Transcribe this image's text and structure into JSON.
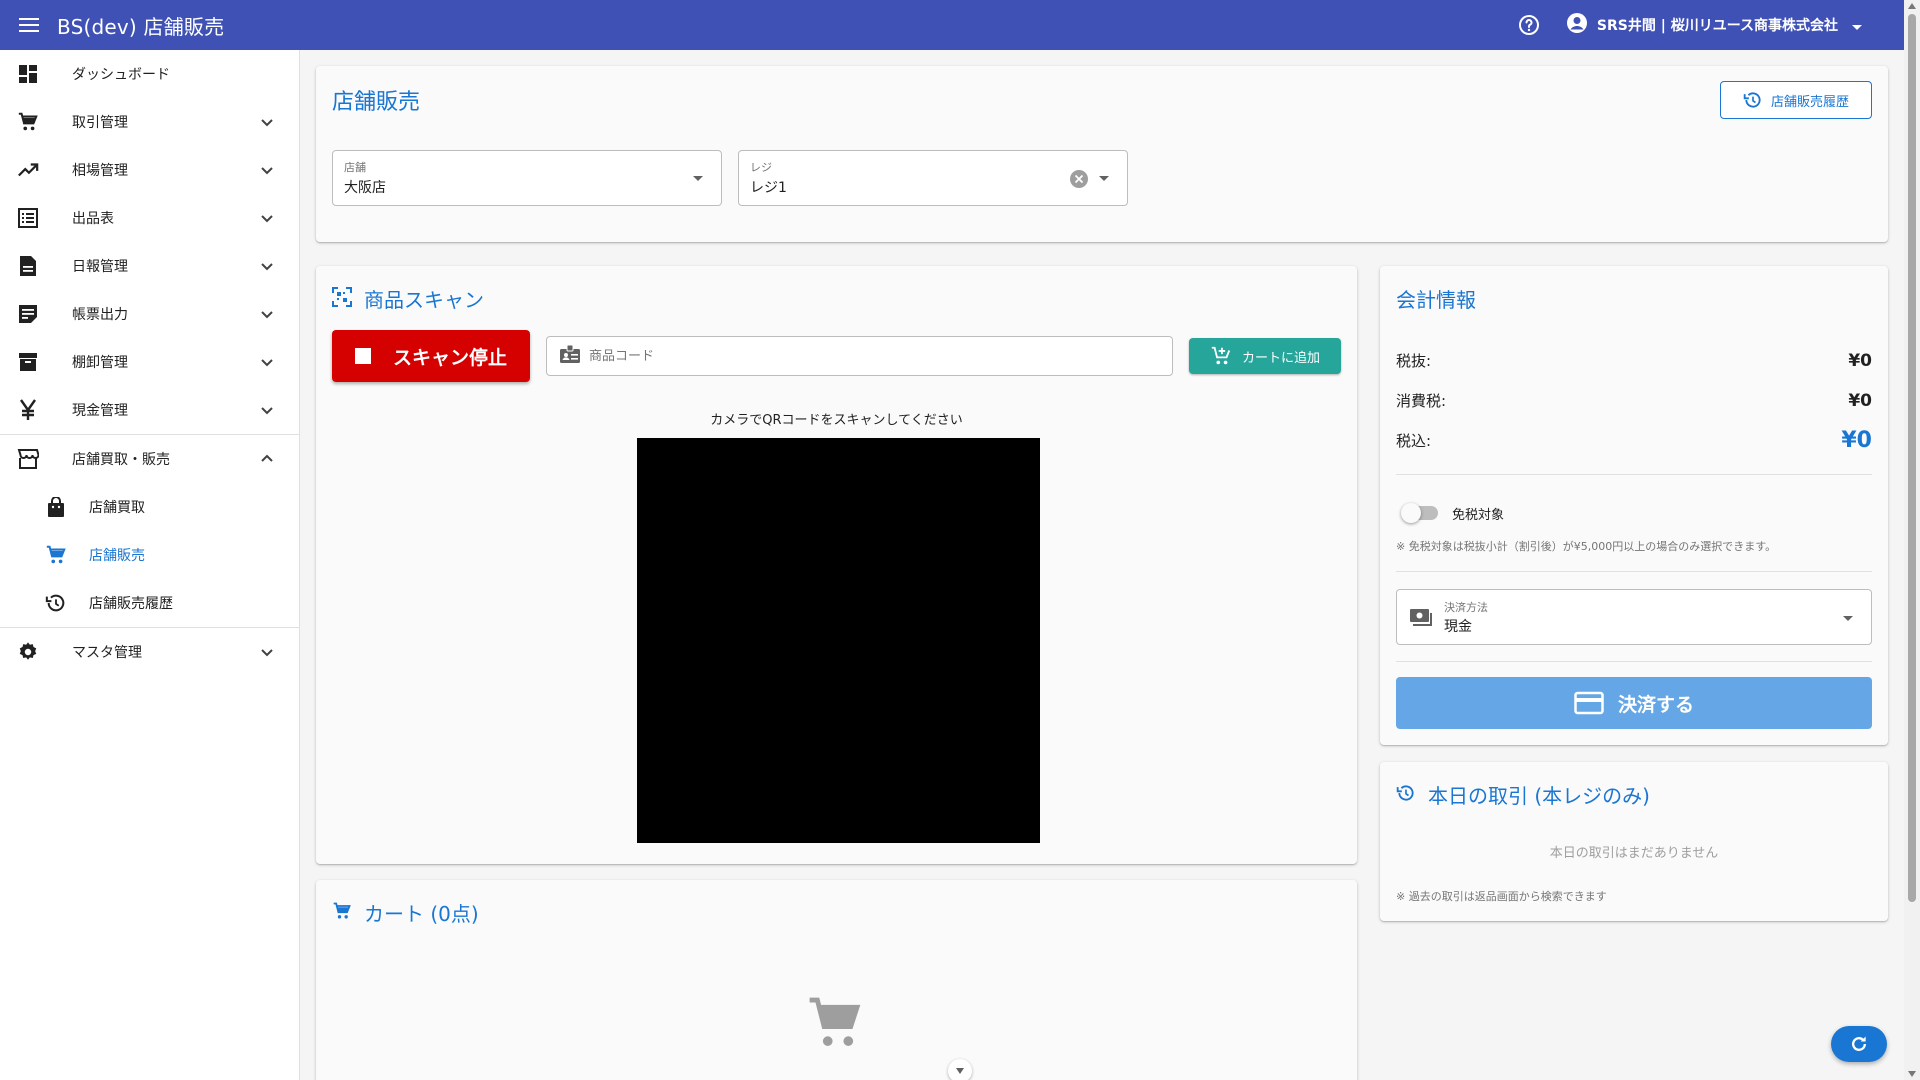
{
  "app": {
    "title": "BS(dev) 店舗販売"
  },
  "user": {
    "name": "SRS井間 | 桜川リユース商事株式会社"
  },
  "sidebar": {
    "items": [
      {
        "label": "ダッシュボード",
        "icon": "dashboard-icon"
      },
      {
        "label": "取引管理",
        "icon": "cart-icon"
      },
      {
        "label": "相場管理",
        "icon": "trending-up-icon"
      },
      {
        "label": "出品表",
        "icon": "list-icon"
      },
      {
        "label": "日報管理",
        "icon": "document-icon"
      },
      {
        "label": "帳票出力",
        "icon": "note-icon"
      },
      {
        "label": "棚卸管理",
        "icon": "archive-icon"
      },
      {
        "label": "現金管理",
        "icon": "yen-icon"
      },
      {
        "label": "店舗買取・販売",
        "icon": "store-icon"
      },
      {
        "label": "店舗買取",
        "icon": "bag-icon"
      },
      {
        "label": "店舗販売",
        "icon": "cart-icon"
      },
      {
        "label": "店舗販売履歴",
        "icon": "history-icon"
      },
      {
        "label": "マスタ管理",
        "icon": "gear-icon"
      }
    ]
  },
  "header_card": {
    "title": "店舗販売",
    "history_button": "店舗販売履歴",
    "store": {
      "label": "店舗",
      "value": "大阪店"
    },
    "register": {
      "label": "レジ",
      "value": "レジ1"
    }
  },
  "scan": {
    "title": "商品スキャン",
    "stop_button": "スキャン停止",
    "code_placeholder": "商品コード",
    "add_button": "カートに追加",
    "hint": "カメラでQRコードをスキャンしてください"
  },
  "cart": {
    "title": "カート (0点)"
  },
  "checkout": {
    "title": "会計情報",
    "rows": [
      {
        "label": "税抜:",
        "value": "¥0"
      },
      {
        "label": "消費税:",
        "value": "¥0"
      },
      {
        "label": "税込:",
        "value": "¥0"
      }
    ],
    "tax_free_label": "免税対象",
    "tax_free_on": false,
    "tax_free_note": "※ 免税対象は税抜小計（割引後）が¥5,000円以上の場合のみ選択できます。",
    "payment": {
      "label": "決済方法",
      "value": "現金"
    },
    "pay_button": "決済する"
  },
  "today": {
    "title": "本日の取引 (本レジのみ)",
    "empty": "本日の取引はまだありません",
    "note": "※ 過去の取引は返品画面から検索できます"
  },
  "colors": {
    "primary": "#3f51b5",
    "accent": "#1976d2",
    "danger": "#d50000",
    "teal": "#26a69a"
  }
}
